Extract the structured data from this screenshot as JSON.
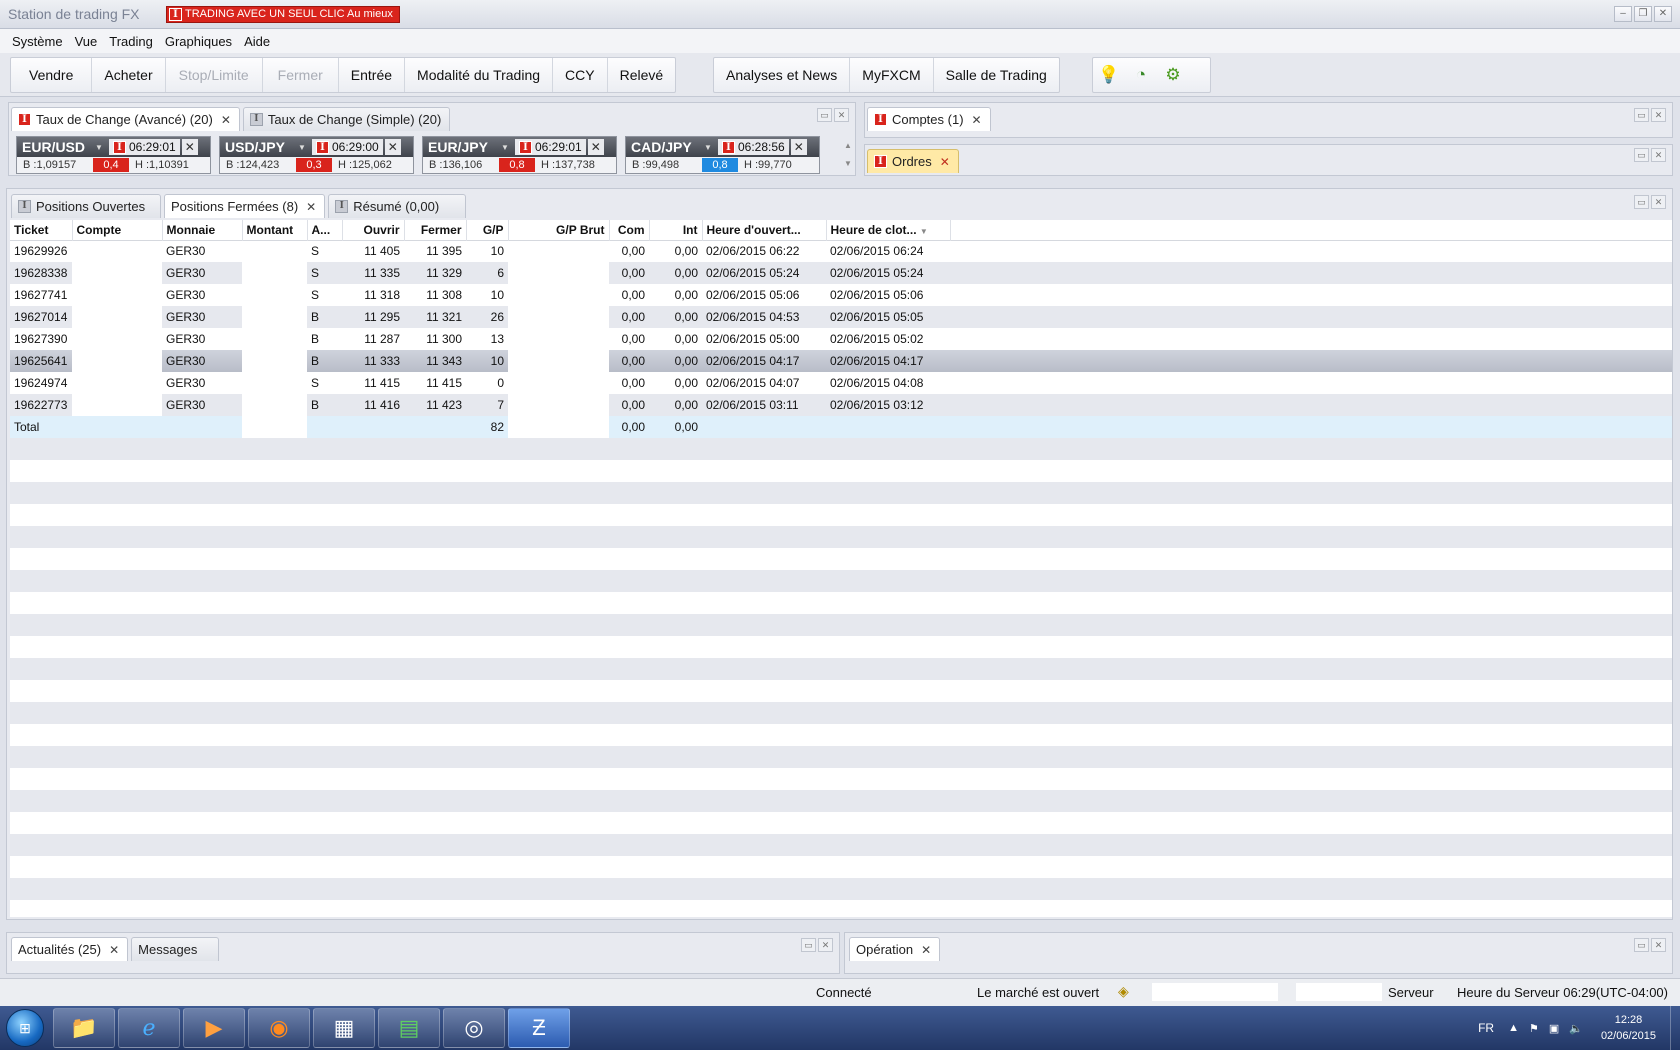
{
  "window": {
    "title": "Station de trading FX",
    "oneclick": "TRADING AVEC UN SEUL CLIC Au mieux",
    "badge": "I"
  },
  "menu": [
    "Système",
    "Vue",
    "Trading",
    "Graphiques",
    "Aide"
  ],
  "toolbar": {
    "group1": [
      "Vendre",
      "Acheter",
      "Stop/Limite",
      "Fermer",
      "Entrée",
      "Modalité du Trading",
      "CCY",
      "Relevé"
    ],
    "group2": [
      "Analyses et News",
      "MyFXCM",
      "Salle de Trading"
    ]
  },
  "rates_panel": {
    "tabs": [
      "Taux de Change (Avancé) (20)",
      "Taux de Change (Simple) (20)"
    ],
    "tickers": [
      {
        "symbol": "EUR/USD",
        "time": "06:29:01",
        "bid": "B :1,09157",
        "spread": "0,4",
        "high": "H :1,10391",
        "spread_color": "#d9241c"
      },
      {
        "symbol": "USD/JPY",
        "time": "06:29:00",
        "bid": "B :124,423",
        "spread": "0,3",
        "high": "H :125,062",
        "spread_color": "#d9241c"
      },
      {
        "symbol": "EUR/JPY",
        "time": "06:29:01",
        "bid": "B :136,106",
        "spread": "0,8",
        "high": "H :137,738",
        "spread_color": "#d9241c"
      },
      {
        "symbol": "CAD/JPY",
        "time": "06:28:56",
        "bid": "B :99,498",
        "spread": "0,8",
        "high": "H :99,770",
        "spread_color": "#1f8ae0"
      }
    ]
  },
  "accounts_panel": {
    "tab": "Comptes (1)"
  },
  "orders_panel": {
    "tab": "Ordres"
  },
  "positions_panel": {
    "tabs": [
      "Positions Ouvertes",
      "Positions Fermées (8)",
      "Résumé (0,00)"
    ],
    "columns": [
      "Ticket",
      "Compte",
      "Monnaie",
      "Montant",
      "A...",
      "Ouvrir",
      "Fermer",
      "G/P",
      "G/P Brut",
      "Com",
      "Int",
      "Heure d'ouvert...",
      "Heure de clot..."
    ],
    "rows": [
      {
        "ticket": "19629926",
        "currency": "GER30",
        "side": "S",
        "open": "11 405",
        "close": "11 395",
        "gp": "10",
        "com": "0,00",
        "int": "0,00",
        "open_time": "02/06/2015 06:22",
        "close_time": "02/06/2015 06:24"
      },
      {
        "ticket": "19628338",
        "currency": "GER30",
        "side": "S",
        "open": "11 335",
        "close": "11 329",
        "gp": "6",
        "com": "0,00",
        "int": "0,00",
        "open_time": "02/06/2015 05:24",
        "close_time": "02/06/2015 05:24"
      },
      {
        "ticket": "19627741",
        "currency": "GER30",
        "side": "S",
        "open": "11 318",
        "close": "11 308",
        "gp": "10",
        "com": "0,00",
        "int": "0,00",
        "open_time": "02/06/2015 05:06",
        "close_time": "02/06/2015 05:06"
      },
      {
        "ticket": "19627014",
        "currency": "GER30",
        "side": "B",
        "open": "11 295",
        "close": "11 321",
        "gp": "26",
        "com": "0,00",
        "int": "0,00",
        "open_time": "02/06/2015 04:53",
        "close_time": "02/06/2015 05:05"
      },
      {
        "ticket": "19627390",
        "currency": "GER30",
        "side": "B",
        "open": "11 287",
        "close": "11 300",
        "gp": "13",
        "com": "0,00",
        "int": "0,00",
        "open_time": "02/06/2015 05:00",
        "close_time": "02/06/2015 05:02"
      },
      {
        "ticket": "19625641",
        "currency": "GER30",
        "side": "B",
        "open": "11 333",
        "close": "11 343",
        "gp": "10",
        "com": "0,00",
        "int": "0,00",
        "open_time": "02/06/2015 04:17",
        "close_time": "02/06/2015 04:17"
      },
      {
        "ticket": "19624974",
        "currency": "GER30",
        "side": "S",
        "open": "11 415",
        "close": "11 415",
        "gp": "0",
        "com": "0,00",
        "int": "0,00",
        "open_time": "02/06/2015 04:07",
        "close_time": "02/06/2015 04:08"
      },
      {
        "ticket": "19622773",
        "currency": "GER30",
        "side": "B",
        "open": "11 416",
        "close": "11 423",
        "gp": "7",
        "com": "0,00",
        "int": "0,00",
        "open_time": "02/06/2015 03:11",
        "close_time": "02/06/2015 03:12"
      }
    ],
    "total": {
      "label": "Total",
      "gp": "82",
      "com": "0,00",
      "int": "0,00"
    }
  },
  "bottom_left": {
    "tabs": [
      "Actualités (25)",
      "Messages"
    ]
  },
  "bottom_right": {
    "tab": "Opération"
  },
  "status": {
    "connected": "Connecté",
    "market": "Le marché est ouvert",
    "server": "Serveur",
    "server_time": "Heure du Serveur 06:29(UTC-04:00)"
  },
  "taskbar": {
    "lang": "FR",
    "time": "12:28",
    "date": "02/06/2015"
  }
}
